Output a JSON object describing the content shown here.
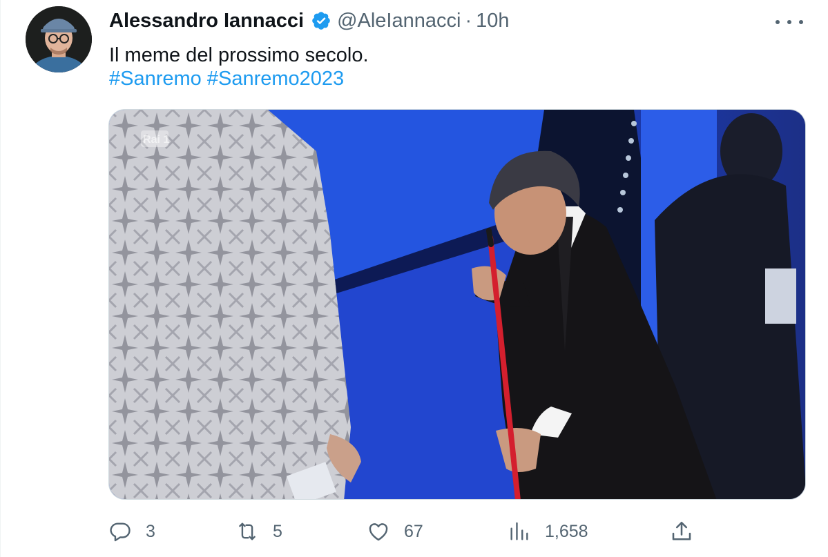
{
  "author": {
    "name": "Alessandro Iannacci",
    "handle": "@AleIannacci",
    "separator": "·",
    "time": "10h",
    "verified": true,
    "avatar_icon": "profile-photo"
  },
  "tweet": {
    "text": "Il meme del prossimo secolo.",
    "hashtags": [
      "#Sanremo",
      "#Sanremo2023"
    ]
  },
  "media": {
    "watermark": "Rai 1"
  },
  "actions": {
    "replies": "3",
    "retweets": "5",
    "likes": "67",
    "views": "1,658"
  },
  "colors": {
    "link": "#1d9bf0",
    "secondary_text": "#536471",
    "primary_text": "#0f1419"
  },
  "icons": {
    "more": "more-dots-icon",
    "reply": "reply-bubble-icon",
    "retweet": "retweet-icon",
    "like": "heart-icon",
    "views": "views-bars-icon",
    "share": "share-icon"
  }
}
